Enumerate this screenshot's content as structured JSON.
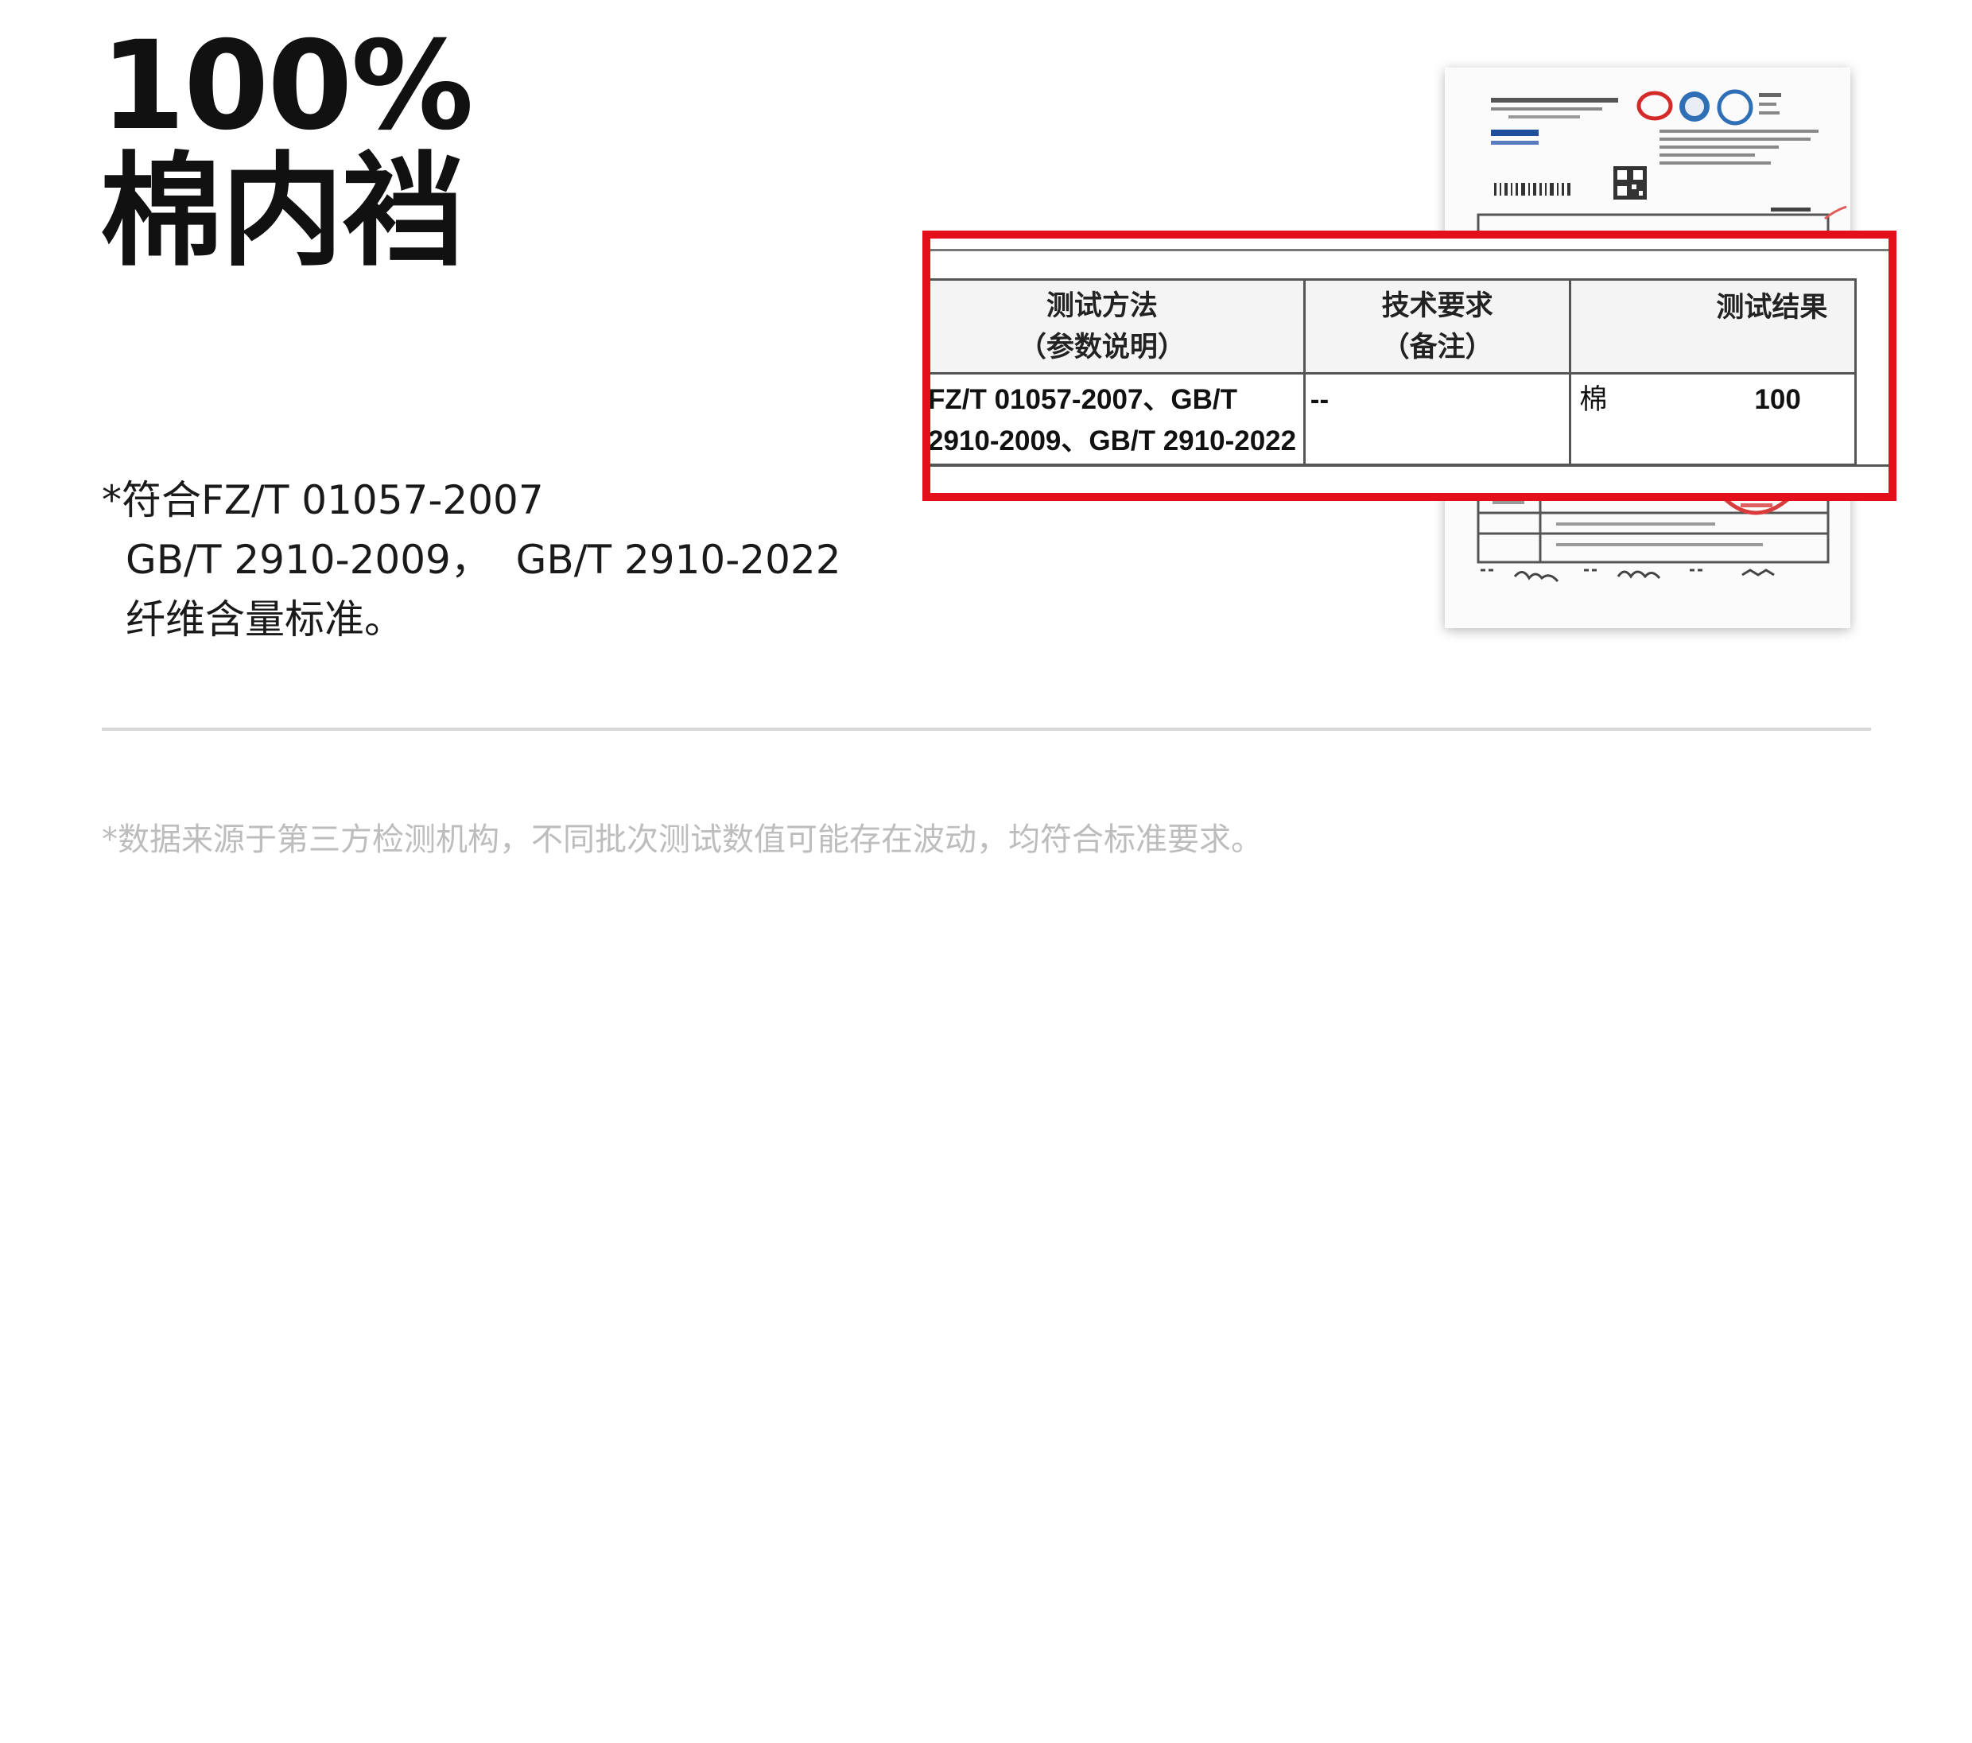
{
  "headline": {
    "line1": "100%",
    "line2": "棉内裆"
  },
  "standards_note": {
    "line1": "*符合FZ/T 01057-2007",
    "line2": "GB/T 2910-2009，  GB/T 2910-2022",
    "line3": "纤维含量标准。"
  },
  "footnote": "*数据来源于第三方检测机构，不同批次测试数值可能存在波动，均符合标准要求。",
  "report_table": {
    "headers": [
      {
        "line1": "测试方法",
        "line2": "（参数说明）"
      },
      {
        "line1": "技术要求",
        "line2": "（备注）"
      },
      {
        "line1": "测试结果",
        "line2": ""
      }
    ],
    "row": {
      "method_line1": "FZ/T 01057-2007、GB/T",
      "method_line2": "2910-2009、GB/T 2910-2022",
      "requirement": "--",
      "fiber": "棉",
      "value": "100"
    }
  },
  "colors": {
    "callout_border": "#e3101b",
    "divider": "#d6d6d6",
    "footnote_text": "#bdbdbd",
    "headline_text": "#111111"
  },
  "icons": [
    "test-report-document-image",
    "certification-logos-image",
    "qr-code-image",
    "barcode-image",
    "red-stamp-image",
    "signatures-image"
  ]
}
